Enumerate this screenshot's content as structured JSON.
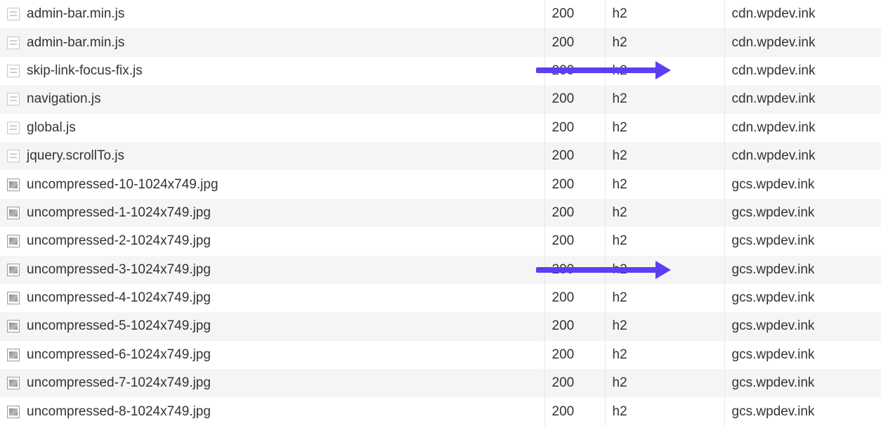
{
  "rows": [
    {
      "name": "admin-bar.min.js",
      "type": "script",
      "status": "200",
      "protocol": "h2",
      "domain": "cdn.wpdev.ink"
    },
    {
      "name": "admin-bar.min.js",
      "type": "script",
      "status": "200",
      "protocol": "h2",
      "domain": "cdn.wpdev.ink"
    },
    {
      "name": "skip-link-focus-fix.js",
      "type": "script",
      "status": "200",
      "protocol": "h2",
      "domain": "cdn.wpdev.ink"
    },
    {
      "name": "navigation.js",
      "type": "script",
      "status": "200",
      "protocol": "h2",
      "domain": "cdn.wpdev.ink"
    },
    {
      "name": "global.js",
      "type": "script",
      "status": "200",
      "protocol": "h2",
      "domain": "cdn.wpdev.ink"
    },
    {
      "name": "jquery.scrollTo.js",
      "type": "script",
      "status": "200",
      "protocol": "h2",
      "domain": "cdn.wpdev.ink"
    },
    {
      "name": "uncompressed-10-1024x749.jpg",
      "type": "image",
      "status": "200",
      "protocol": "h2",
      "domain": "gcs.wpdev.ink"
    },
    {
      "name": "uncompressed-1-1024x749.jpg",
      "type": "image",
      "status": "200",
      "protocol": "h2",
      "domain": "gcs.wpdev.ink"
    },
    {
      "name": "uncompressed-2-1024x749.jpg",
      "type": "image",
      "status": "200",
      "protocol": "h2",
      "domain": "gcs.wpdev.ink"
    },
    {
      "name": "uncompressed-3-1024x749.jpg",
      "type": "image",
      "status": "200",
      "protocol": "h2",
      "domain": "gcs.wpdev.ink"
    },
    {
      "name": "uncompressed-4-1024x749.jpg",
      "type": "image",
      "status": "200",
      "protocol": "h2",
      "domain": "gcs.wpdev.ink"
    },
    {
      "name": "uncompressed-5-1024x749.jpg",
      "type": "image",
      "status": "200",
      "protocol": "h2",
      "domain": "gcs.wpdev.ink"
    },
    {
      "name": "uncompressed-6-1024x749.jpg",
      "type": "image",
      "status": "200",
      "protocol": "h2",
      "domain": "gcs.wpdev.ink"
    },
    {
      "name": "uncompressed-7-1024x749.jpg",
      "type": "image",
      "status": "200",
      "protocol": "h2",
      "domain": "gcs.wpdev.ink"
    },
    {
      "name": "uncompressed-8-1024x749.jpg",
      "type": "image",
      "status": "200",
      "protocol": "h2",
      "domain": "gcs.wpdev.ink"
    }
  ],
  "annotations": {
    "arrow_color": "#5b3ff2",
    "arrows": [
      {
        "points_to_row": 2,
        "target_column": "domain"
      },
      {
        "points_to_row": 9,
        "target_column": "domain"
      }
    ]
  }
}
